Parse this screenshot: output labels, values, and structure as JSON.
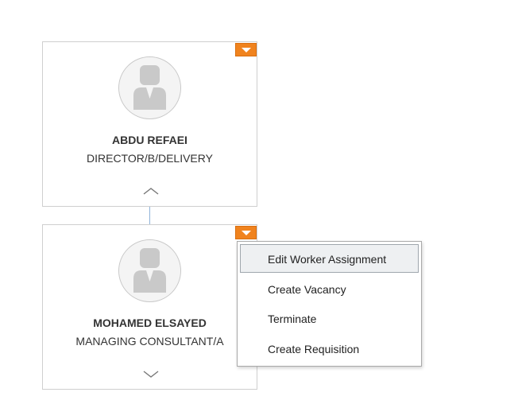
{
  "org_chart": {
    "manager": {
      "name": "ABDU REFAEI",
      "title": "DIRECTOR/B/DELIVERY",
      "menu_icon": "dropdown-arrow-icon",
      "toggle_icon": "chevron-up-icon"
    },
    "employee": {
      "name": "MOHAMED ELSAYED",
      "title": "MANAGING CONSULTANT/A",
      "menu_icon": "dropdown-arrow-icon",
      "toggle_icon": "chevron-down-icon"
    }
  },
  "context_menu": {
    "items": [
      {
        "label": "Edit Worker Assignment",
        "hovered": true
      },
      {
        "label": "Create Vacancy",
        "hovered": false
      },
      {
        "label": "Terminate",
        "hovered": false
      },
      {
        "label": "Create Requisition",
        "hovered": false
      }
    ]
  },
  "colors": {
    "menu_trigger": "#f0831e",
    "card_border": "#cfcfcf",
    "connector": "#8fb3d9",
    "hover_bg": "#eef0f2"
  }
}
